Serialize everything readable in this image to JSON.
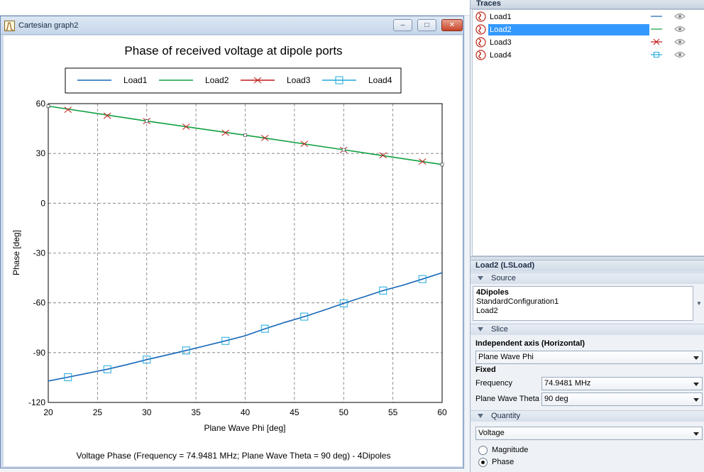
{
  "window": {
    "title": "Cartesian graph2",
    "minimize_glyph": "–",
    "maximize_glyph": "□",
    "close_glyph": "✕"
  },
  "chart_data": {
    "type": "line",
    "title": "Phase of received voltage at dipole ports",
    "xlabel": "Plane Wave Phi [deg]",
    "ylabel": "Phase [deg]",
    "footer": "Voltage Phase (Frequency = 74.9481 MHz; Plane Wave Theta = 90 deg) - 4Dipoles",
    "xlim": [
      20,
      60
    ],
    "ylim": [
      -120,
      60
    ],
    "x_ticks": [
      20,
      25,
      30,
      35,
      40,
      45,
      50,
      55,
      60
    ],
    "y_ticks": [
      60,
      30,
      0,
      -30,
      -60,
      -90,
      -120
    ],
    "grid": true,
    "legend_position": "top",
    "series": [
      {
        "name": "Load1",
        "color": "#1565b8",
        "marker": "none",
        "x": [
          20,
          22,
          24,
          26,
          28,
          30,
          32,
          34,
          36,
          38,
          40,
          42,
          44,
          46,
          48,
          50,
          52,
          54,
          56,
          58,
          60
        ],
        "y": [
          -107.1,
          -104.8,
          -102.4,
          -100.0,
          -97.2,
          -94.2,
          -91.5,
          -88.7,
          -85.8,
          -82.9,
          -79.8,
          -75.6,
          -71.8,
          -68.3,
          -64.4,
          -60.3,
          -56.5,
          -52.6,
          -49.4,
          -45.7,
          -41.9
        ]
      },
      {
        "name": "Load2",
        "color": "#10a040",
        "marker": "none",
        "x": [
          20,
          30,
          40,
          50,
          60
        ],
        "y": [
          58.5,
          49.5,
          41.0,
          32.2,
          23.3
        ]
      },
      {
        "name": "Load3",
        "color": "#c01818",
        "marker": "cross",
        "x": [
          22,
          26,
          30,
          34,
          38,
          42,
          46,
          50,
          54,
          58
        ],
        "y": [
          56.3,
          52.7,
          49.5,
          46.1,
          42.4,
          39.3,
          35.8,
          32.1,
          28.9,
          25.1
        ]
      },
      {
        "name": "Load4",
        "color": "#1fa9db",
        "marker": "square",
        "x": [
          22,
          26,
          30,
          34,
          38,
          42,
          46,
          50,
          54,
          58
        ],
        "y": [
          -104.8,
          -100.0,
          -94.2,
          -88.7,
          -82.9,
          -75.6,
          -68.3,
          -60.3,
          -52.6,
          -45.7
        ]
      }
    ]
  },
  "traces_panel": {
    "title": "Traces",
    "items": [
      {
        "label": "Load1",
        "selected": false,
        "style_icon": "line-icon",
        "line_color": "#1565b8"
      },
      {
        "label": "Load2",
        "selected": true,
        "style_icon": "line-icon",
        "line_color": "#10a040"
      },
      {
        "label": "Load3",
        "selected": false,
        "style_icon": "cross-marker-icon",
        "line_color": "#c01818"
      },
      {
        "label": "Load4",
        "selected": false,
        "style_icon": "square-marker-icon",
        "line_color": "#1fa9db"
      }
    ],
    "trace_icon": "trace-icon",
    "visibility_icon": "eye-icon"
  },
  "properties": {
    "title": "Load2 (LSLoad)",
    "source": {
      "header": "Source",
      "line1": "4Dipoles",
      "line2": "StandardConfiguration1",
      "line3": "Load2"
    },
    "slice": {
      "header": "Slice",
      "independent_axis_label": "Independent axis (Horizontal)",
      "independent_axis_value": "Plane Wave Phi",
      "fixed_label": "Fixed",
      "frequency_label": "Frequency",
      "frequency_value": "74.9481 MHz",
      "theta_label": "Plane Wave Theta",
      "theta_value": "90 deg"
    },
    "quantity": {
      "header": "Quantity",
      "value": "Voltage",
      "options": [
        {
          "label": "Magnitude",
          "checked": false
        },
        {
          "label": "Phase",
          "checked": true
        }
      ]
    }
  }
}
